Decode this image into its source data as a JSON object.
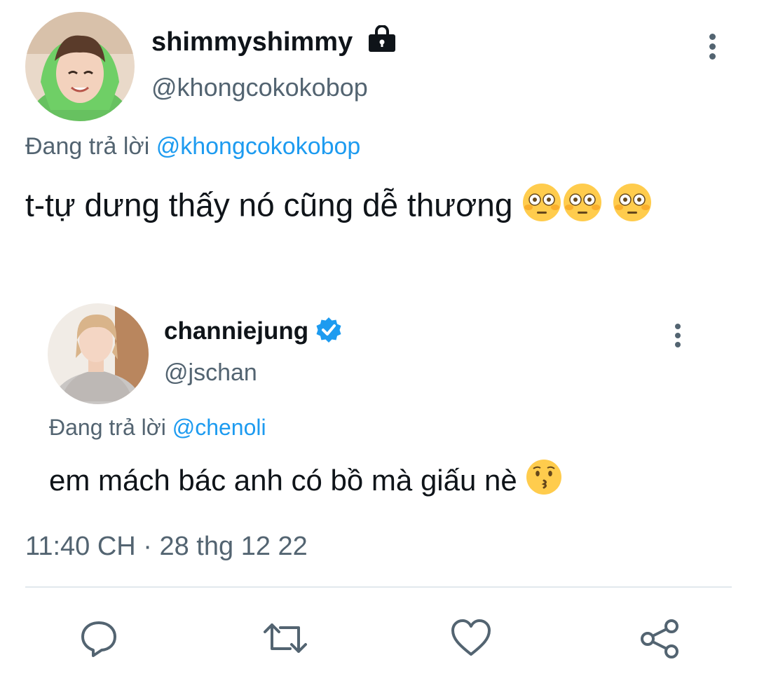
{
  "main_tweet": {
    "display_name": "shimmyshimmy",
    "lock_icon": "lock-icon",
    "handle": "@khongcokokobop",
    "replying_prefix": "Đang trả lời",
    "replying_to": "@khongcokokobop",
    "text": "t-tự dưng thấy nó cũng dễ thương",
    "emoji": "flushed-face-icon",
    "timestamp": "11:40 CH · 28 thg 12 22"
  },
  "quoted_tweet": {
    "display_name": "channiejung",
    "verified_icon": "verified-badge-icon",
    "handle": "@jschan",
    "replying_prefix": "Đang trả lời",
    "replying_to": "@chenoli",
    "text": "em mách bác anh có bồ mà giấu nè",
    "emoji": "kissing-face-icon"
  },
  "actions": [
    "reply-icon",
    "retweet-icon",
    "like-icon",
    "share-icon"
  ],
  "colors": {
    "link": "#1d9bf0",
    "secondary_text": "#536471",
    "primary_text": "#0f1419",
    "divider": "#e1e8ed"
  }
}
